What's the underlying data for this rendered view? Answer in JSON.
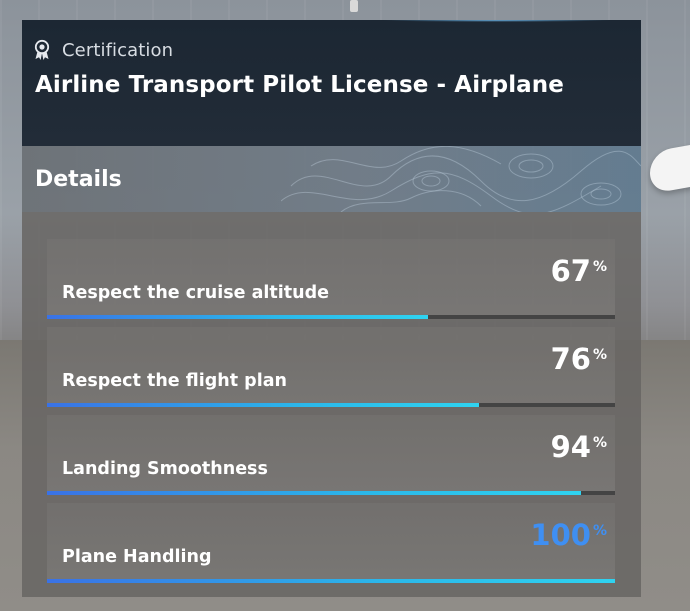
{
  "header": {
    "category_label": "Certification",
    "category_icon": "certificate-badge-icon",
    "license_title": "Airline Transport Pilot License - Airplane"
  },
  "details": {
    "title": "Details",
    "percent_symbol": "%",
    "criteria": [
      {
        "label": "Respect the cruise altitude",
        "value": "67",
        "progress": 0.67
      },
      {
        "label": "Respect the flight plan",
        "value": "76",
        "progress": 0.76
      },
      {
        "label": "Landing Smoothness",
        "value": "94",
        "progress": 0.94
      },
      {
        "label": "Plane Handling",
        "value": "100",
        "progress": 1.0
      }
    ]
  },
  "colors": {
    "header_bg": "#1f2934",
    "progress_start": "#3a72e6",
    "progress_end": "#2fd3f0",
    "perfect_score": "#3f8ff2",
    "track": "#444444"
  }
}
